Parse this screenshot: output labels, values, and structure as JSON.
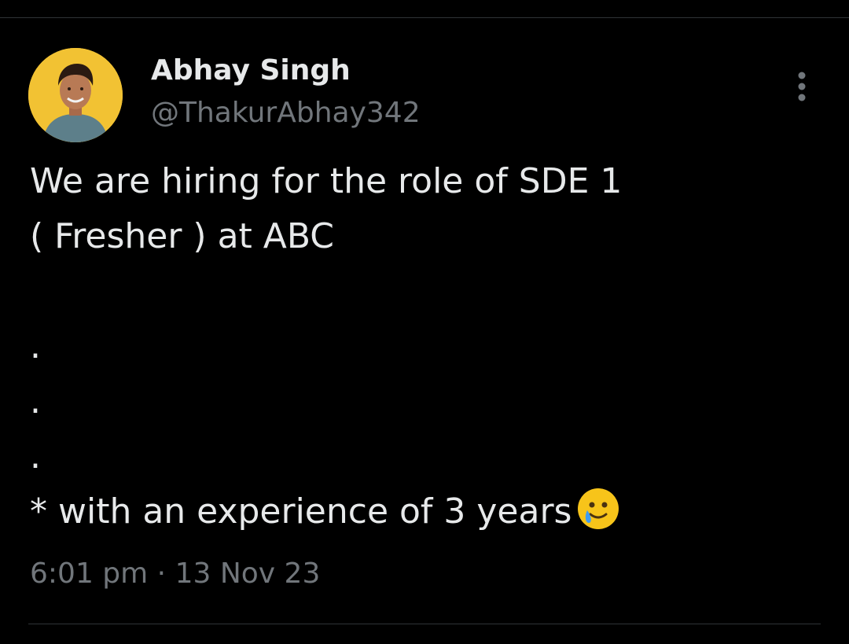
{
  "tweet": {
    "author_name": "Abhay Singh",
    "author_handle": "@ThakurAbhay342",
    "avatar_icon": "profile-photo",
    "more_icon": "vertical-ellipsis-icon",
    "lines": [
      "We are hiring for the role of SDE 1",
      "( Fresher ) at ABC",
      "",
      ".",
      ".",
      ".",
      "* with an experience of 3 years"
    ],
    "emoji": "smiling-face-with-tear-emoji",
    "time": "6:01 pm",
    "separator": "·",
    "date": "13 Nov 23"
  },
  "colors": {
    "background": "#000000",
    "primary_text": "#e7e9ea",
    "secondary_text": "#71767b",
    "divider": "#2f3336",
    "avatar_bg": "#f2c233"
  }
}
